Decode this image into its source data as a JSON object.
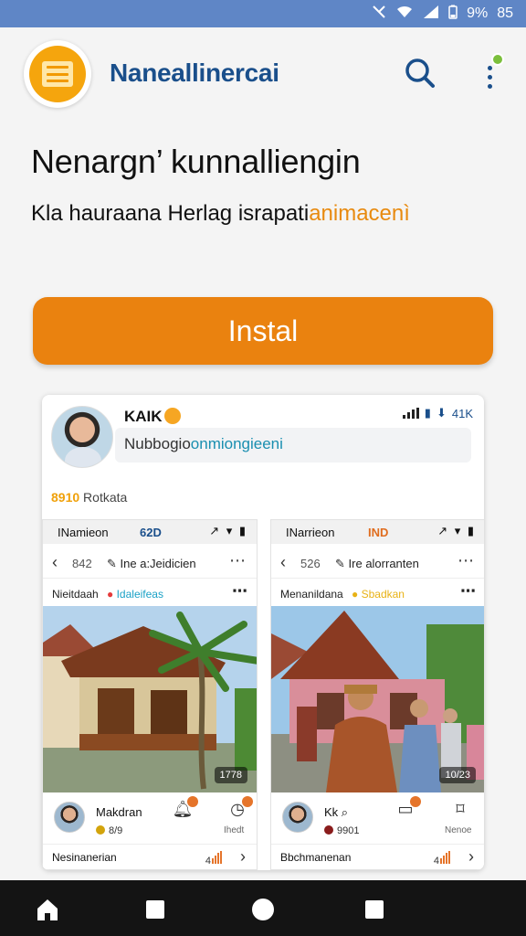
{
  "status_bar": {
    "battery": "9%",
    "time": "85",
    "icons": [
      "no-signal-icon",
      "wifi-icon",
      "signal-icon",
      "battery-icon"
    ]
  },
  "header": {
    "app_name": "Naneallinercai",
    "icons": [
      "app-logo",
      "search-icon",
      "overflow-menu-icon"
    ]
  },
  "hero": {
    "title": "Nenargn’ kunnalliengin",
    "subtitle": "Kla hauraana Herlag israpati",
    "subtitle_accent": "animacenì"
  },
  "install": {
    "label": "Instal"
  },
  "preview": {
    "profile_name": "KAIK",
    "stats": "41K",
    "profile_sub_main": "Nubbogio",
    "profile_sub_accent": "onmiongieeni",
    "meta_number": "8910",
    "meta_text": "Rotkata",
    "screens": [
      {
        "status_title": "INamieon",
        "status_code": "62D",
        "nav_count": "842",
        "nav_title": "Ine a:Jeidicien",
        "tag_name": "Nieitdaah",
        "tag_label": "Idaleifeas",
        "photo_badge": "1778",
        "author": "Makdran",
        "author_meta": "8/9",
        "icon_a_label": "",
        "icon_b_label": "Ihedt",
        "footer_text": "Nesinanerian",
        "footer_level": "4"
      },
      {
        "status_title": "INarrieon",
        "status_code": "IND",
        "nav_count": "526",
        "nav_title": "Ire alorranten",
        "tag_name": "Menanildana",
        "tag_label": "Sbadkan",
        "photo_badge": "10/23",
        "author": "Kk",
        "author_meta": "9901",
        "icon_a_label": "",
        "icon_b_label": "Nenoe",
        "footer_text": "Bbchmanenan",
        "footer_level": "4"
      }
    ]
  },
  "navbar": {
    "icons": [
      "home-icon",
      "square-icon",
      "circle-icon",
      "square-icon"
    ]
  },
  "colors": {
    "status_bar": "#5f86c6",
    "brand": "#1a4f8b",
    "accent": "#ea820f",
    "logo": "#f5a50d"
  }
}
